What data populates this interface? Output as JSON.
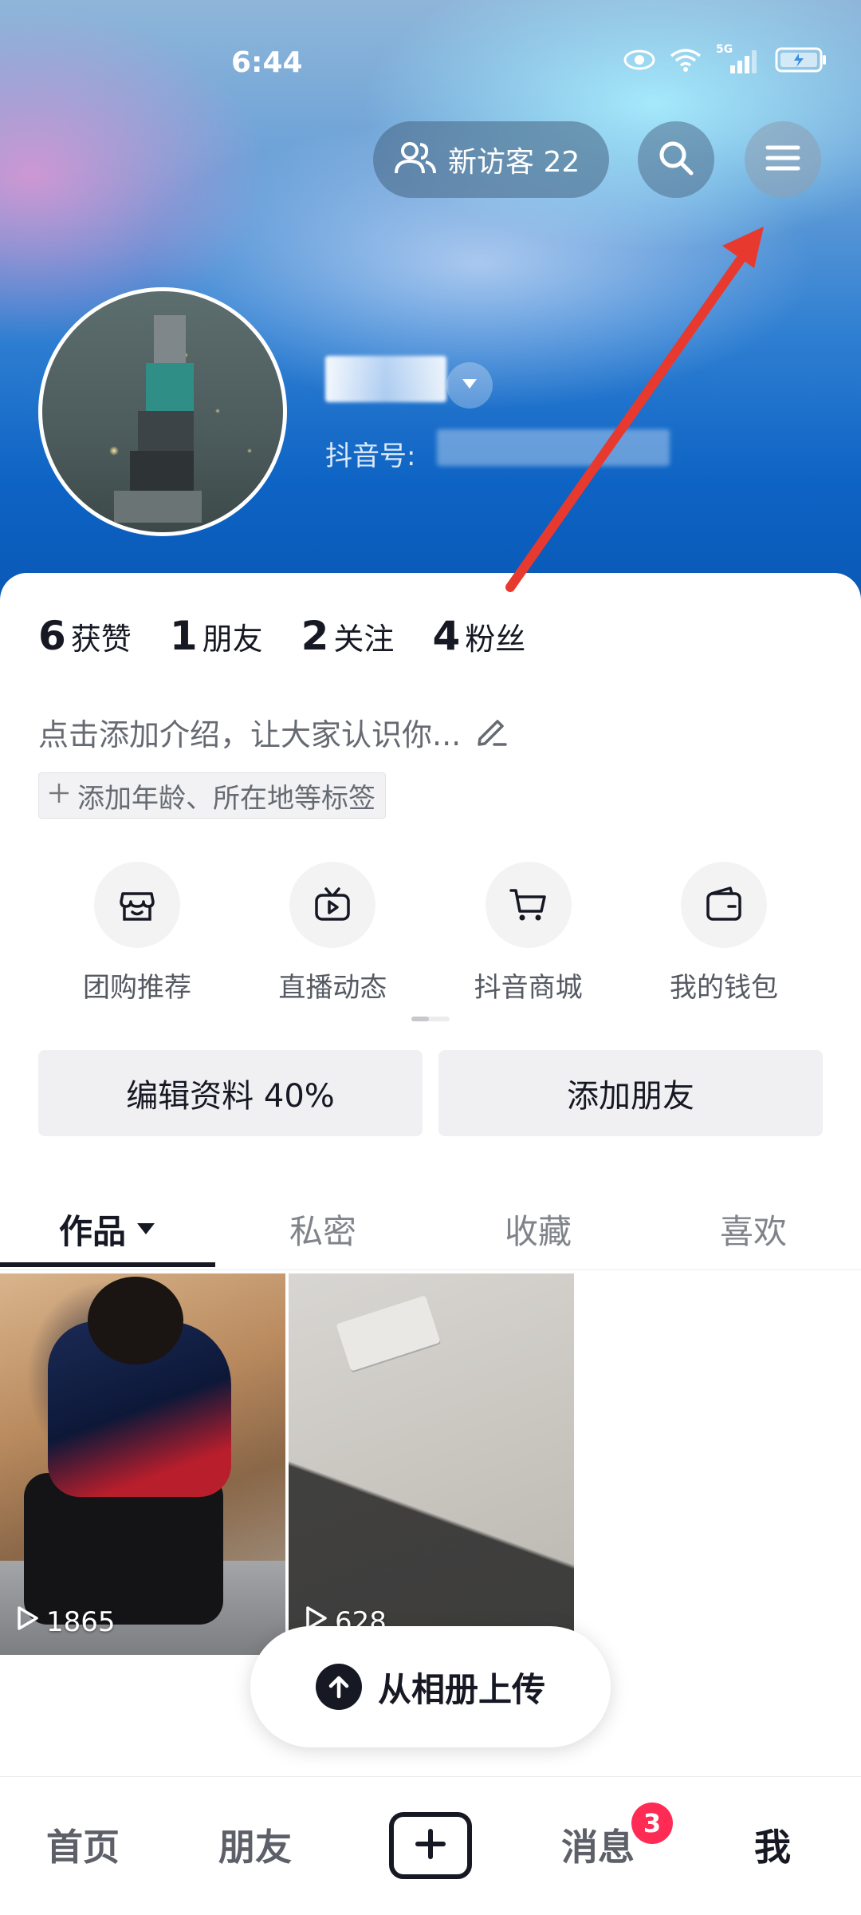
{
  "status_bar": {
    "time": "6:44",
    "network": "5G"
  },
  "header": {
    "visitors_label": "新访客 22"
  },
  "profile": {
    "douyin_id_label": "抖音号:"
  },
  "stats": [
    {
      "num": "6",
      "label": "获赞"
    },
    {
      "num": "1",
      "label": "朋友"
    },
    {
      "num": "2",
      "label": "关注"
    },
    {
      "num": "4",
      "label": "粉丝"
    }
  ],
  "bio": {
    "placeholder": "点击添加介绍，让大家认识你...",
    "tag_prompt": "添加年龄、所在地等标签"
  },
  "shortcuts": [
    {
      "label": "团购推荐",
      "icon": "shop-icon"
    },
    {
      "label": "直播动态",
      "icon": "live-tv-icon"
    },
    {
      "label": "抖音商城",
      "icon": "cart-icon"
    },
    {
      "label": "我的钱包",
      "icon": "wallet-icon"
    }
  ],
  "actions": {
    "edit_profile": "编辑资料 40%",
    "add_friends": "添加朋友"
  },
  "tabs": [
    {
      "label": "作品",
      "active": true
    },
    {
      "label": "私密",
      "active": false
    },
    {
      "label": "收藏",
      "active": false
    },
    {
      "label": "喜欢",
      "active": false
    }
  ],
  "videos": [
    {
      "plays": "1865"
    },
    {
      "plays": "628"
    }
  ],
  "upload": {
    "label": "从相册上传"
  },
  "bottom_nav": {
    "home": "首页",
    "friends": "朋友",
    "messages": "消息",
    "messages_badge": "3",
    "me": "我"
  },
  "colors": {
    "accent_badge": "#fe2c55",
    "text_primary": "#161823",
    "annotation_arrow": "#e8392e"
  }
}
